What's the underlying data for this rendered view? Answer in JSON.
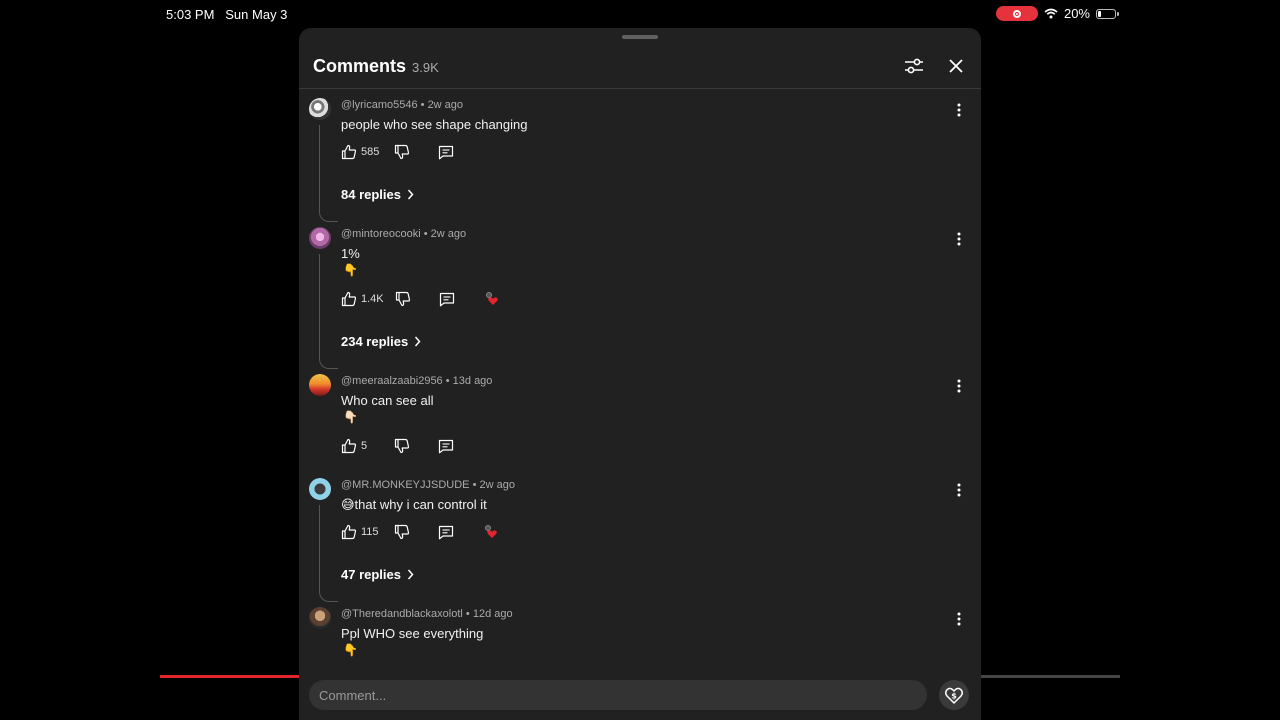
{
  "status_bar": {
    "time": "5:03 PM",
    "date": "Sun May 3",
    "battery": "20%",
    "battery_level": 0.2
  },
  "video": {
    "progress": 0.145,
    "accent": "#e3262e"
  },
  "panel": {
    "title": "Comments",
    "count": "3.9K",
    "filter_icon": "sliders-icon",
    "close_icon": "close-icon"
  },
  "comments": [
    {
      "author": "@lyricamo5546",
      "time": "2w ago",
      "text": "people who see  shape changing",
      "likes": "585",
      "replies": "84 replies",
      "creator_heart": false
    },
    {
      "author": "@mintoreocooki",
      "time": "2w ago",
      "text": "1%",
      "emoji": "👇",
      "likes": "1.4K",
      "replies": "234 replies",
      "creator_heart": true
    },
    {
      "author": "@meeraalzaabi2956",
      "time": "13d ago",
      "text": "Who can see all",
      "emoji": "👇🏻",
      "likes": "5",
      "creator_heart": false
    },
    {
      "author": "@MR.MONKEYJJSDUDE",
      "time": "2w ago",
      "text": "😅that why i can control it",
      "likes": "115",
      "replies": "47 replies",
      "creator_heart": true
    },
    {
      "author": "@Theredandblackaxolotl",
      "time": "12d ago",
      "text": "Ppl WHO see everything",
      "emoji": "👇"
    }
  ],
  "composer": {
    "placeholder": "Comment...",
    "thanks_icon": "super-thanks-icon"
  }
}
